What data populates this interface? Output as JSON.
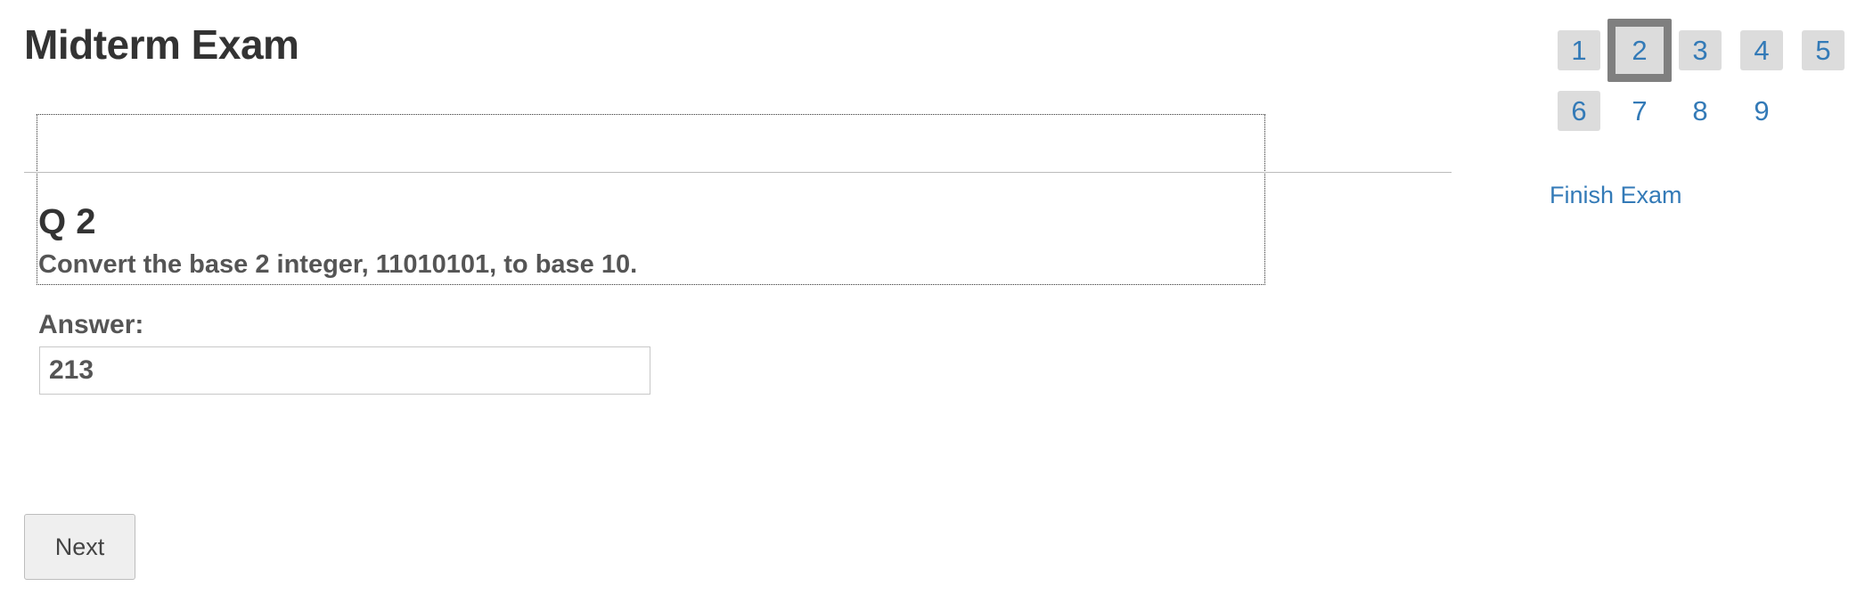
{
  "exam": {
    "title": "Midterm Exam"
  },
  "question": {
    "number_label": "Q 2",
    "text": "Convert the base 2 integer, 11010101, to base 10."
  },
  "answer": {
    "label": "Answer:",
    "value": "213"
  },
  "buttons": {
    "next_label": "Next"
  },
  "question_nav": {
    "current": "2",
    "items": [
      {
        "label": "1",
        "state": "answered"
      },
      {
        "label": "2",
        "state": "current"
      },
      {
        "label": "3",
        "state": "answered"
      },
      {
        "label": "4",
        "state": "answered"
      },
      {
        "label": "5",
        "state": "answered"
      },
      {
        "label": "6",
        "state": "answered"
      },
      {
        "label": "7",
        "state": "unanswered"
      },
      {
        "label": "8",
        "state": "unanswered"
      },
      {
        "label": "9",
        "state": "unanswered"
      }
    ]
  },
  "finish": {
    "label": "Finish Exam"
  },
  "colors": {
    "link": "#337ab7",
    "answered_bg": "#dcdcdc",
    "current_border": "#7f7f7f"
  }
}
